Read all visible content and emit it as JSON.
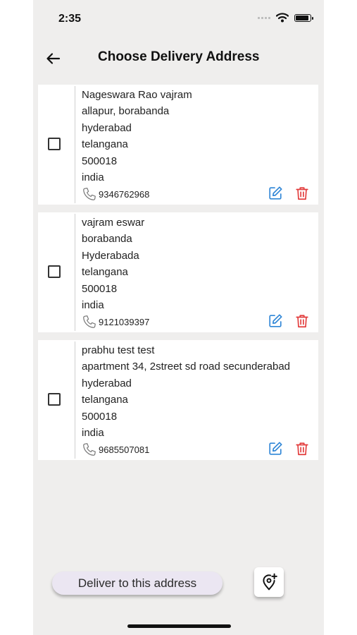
{
  "status_bar": {
    "time": "2:35"
  },
  "header": {
    "title": "Choose Delivery Address"
  },
  "addresses": [
    {
      "name": "Nageswara Rao vajram",
      "street": "allapur, borabanda",
      "city": "hyderabad",
      "state": "telangana",
      "pincode": "500018",
      "country": "india",
      "phone": "9346762968"
    },
    {
      "name": "vajram eswar",
      "street": "borabanda",
      "city": "Hyderabada",
      "state": "telangana",
      "pincode": "500018",
      "country": "india",
      "phone": "9121039397"
    },
    {
      "name": "prabhu test test",
      "street": "apartment 34, 2street sd road secunderabad",
      "city": "hyderabad",
      "state": "telangana",
      "pincode": "500018",
      "country": "india",
      "phone": "9685507081"
    }
  ],
  "actions": {
    "deliver_label": "Deliver to this address"
  },
  "colors": {
    "accent": "#2f86d6",
    "danger": "#e23b3b",
    "background": "#efeeed"
  },
  "icons": {
    "back": "arrow-left-icon",
    "phone": "phone-icon",
    "edit": "edit-icon",
    "delete": "trash-icon",
    "add_location": "add-location-icon"
  }
}
